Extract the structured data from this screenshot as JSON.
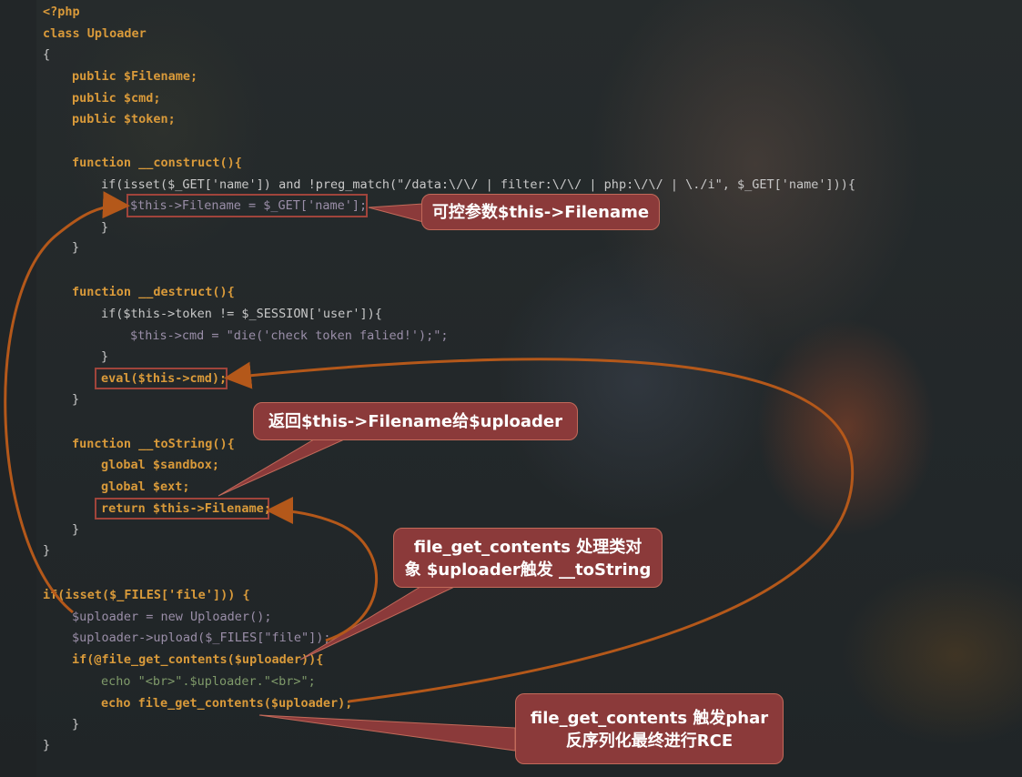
{
  "code_lines": [
    "<?php",
    "class Uploader",
    "{",
    "public $Filename;",
    "public $cmd;",
    "public $token;",
    "function __construct(){",
    "if(isset($_GET['name']) and !preg_match(\"/data:\\/\\/ | filter:\\/\\/ | php:\\/\\/ | \\./i\", $_GET['name'])){",
    "$this->Filename = $_GET['name'];",
    "}",
    "}",
    "function __destruct(){",
    "if($this->token != $_SESSION['user']){",
    "$this->cmd = \"die('check token falied!');\";",
    "}",
    "eval($this->cmd);",
    "}",
    "function __toString(){",
    "global $sandbox;",
    "global $ext;",
    "return $this->Filename;",
    "}",
    "}",
    "if(isset($_FILES['file'])) {",
    "$uploader = new Uploader();",
    "$uploader->upload($_FILES[\"file\"]);",
    "if(@file_get_contents($uploader)){",
    "echo \"<br>\".$uploader.\"<br>\";",
    "echo file_get_contents($uploader);",
    "}",
    "}"
  ],
  "annotations": {
    "a1": "可控参数$this->Filename",
    "a2": "返回$this->Filename给$uploader",
    "a3_line1": "file_get_contents 处理类对",
    "a3_line2": "象 $uploader触发 __toString",
    "a4_line1": "file_get_contents 触发phar",
    "a4_line2": "反序列化最终进行RCE"
  },
  "colors": {
    "keyword": "#d99a3a",
    "variable": "#9a8ea8",
    "string": "#7f9a6a",
    "callout_bg": "#8b3a3a",
    "arrow": "#b4581a",
    "highlight_box": "#a0443b"
  }
}
